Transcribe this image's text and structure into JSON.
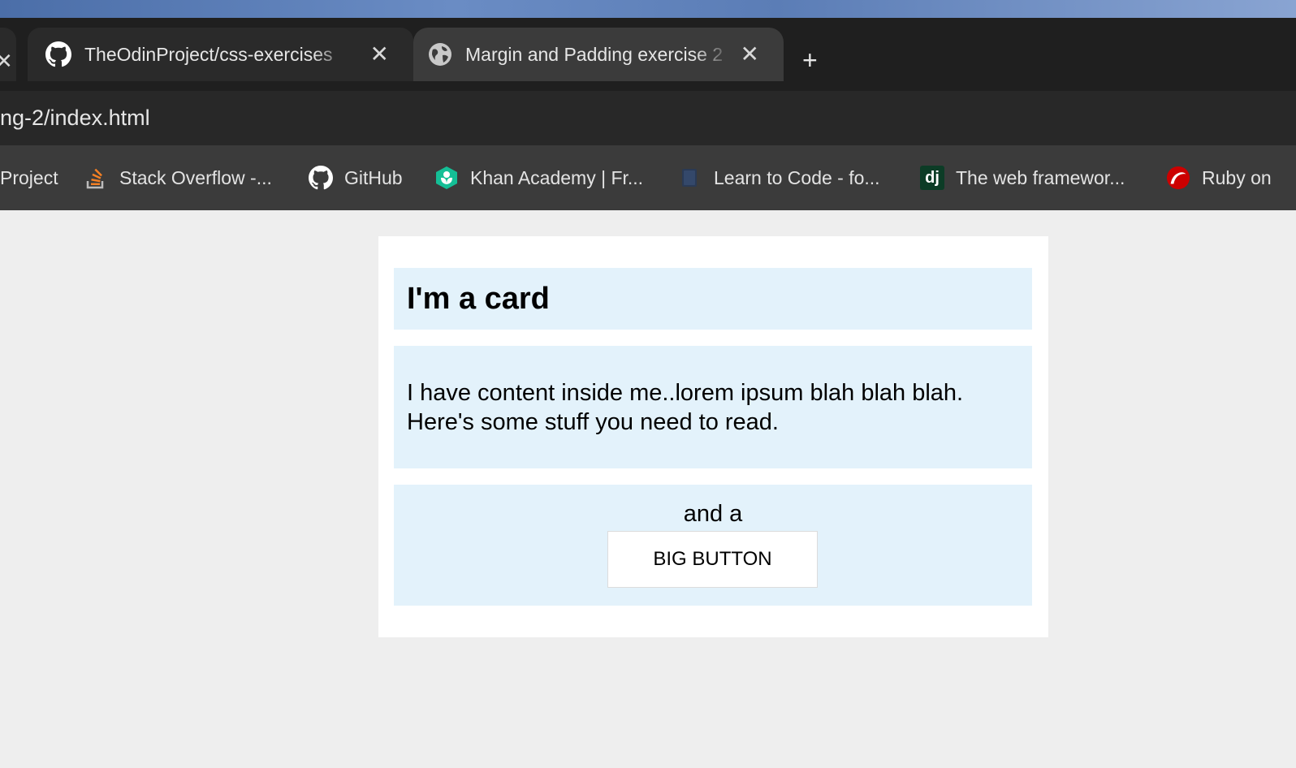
{
  "browser": {
    "tabs": [
      {
        "title": "TheOdinProject/css-exercises",
        "icon": "github-icon",
        "active": false
      },
      {
        "title": "Margin and Padding exercise 2",
        "icon": "globe-icon",
        "active": true
      }
    ],
    "new_tab_label": "+",
    "close_label": "✕",
    "address": "ng-2/index.html",
    "bookmarks": [
      {
        "label": "Project",
        "icon": ""
      },
      {
        "label": "Stack Overflow -...",
        "icon": "stackoverflow-icon"
      },
      {
        "label": "GitHub",
        "icon": "github-icon"
      },
      {
        "label": "Khan Academy | Fr...",
        "icon": "khan-academy-icon"
      },
      {
        "label": "Learn to Code - fo...",
        "icon": "book-icon"
      },
      {
        "label": "The web framewor...",
        "icon": "django-icon",
        "icon_text": "dj"
      },
      {
        "label": "Ruby on",
        "icon": "ruby-icon"
      }
    ]
  },
  "page": {
    "card": {
      "title": "I'm a card",
      "content": "I have content inside me..lorem ipsum blah blah blah. Here's some stuff you need to read.",
      "footer_text": "and a",
      "button_label": "BIG BUTTON"
    }
  },
  "colors": {
    "section_bg": "#e3f2fb",
    "page_bg": "#eeeeee",
    "card_bg": "#ffffff"
  }
}
